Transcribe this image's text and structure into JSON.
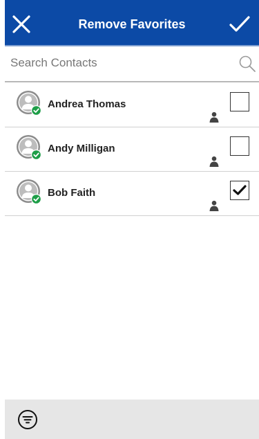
{
  "header": {
    "title": "Remove Favorites",
    "background_color": "#0c4aa6",
    "close_icon": "close-icon",
    "confirm_icon": "checkmark-icon"
  },
  "search": {
    "placeholder": "Search Contacts",
    "value": "",
    "icon": "search-icon"
  },
  "contacts": [
    {
      "name": "Andrea Thomas",
      "checked": false,
      "status": "online"
    },
    {
      "name": "Andy Milligan",
      "checked": false,
      "status": "online"
    },
    {
      "name": "Bob Faith",
      "checked": true,
      "status": "online"
    }
  ],
  "colors": {
    "accent": "#0c4aa6",
    "online_badge": "#1e9e48",
    "footer_bg": "#e6e6e6"
  },
  "footer": {
    "filter_icon": "filter-icon"
  }
}
